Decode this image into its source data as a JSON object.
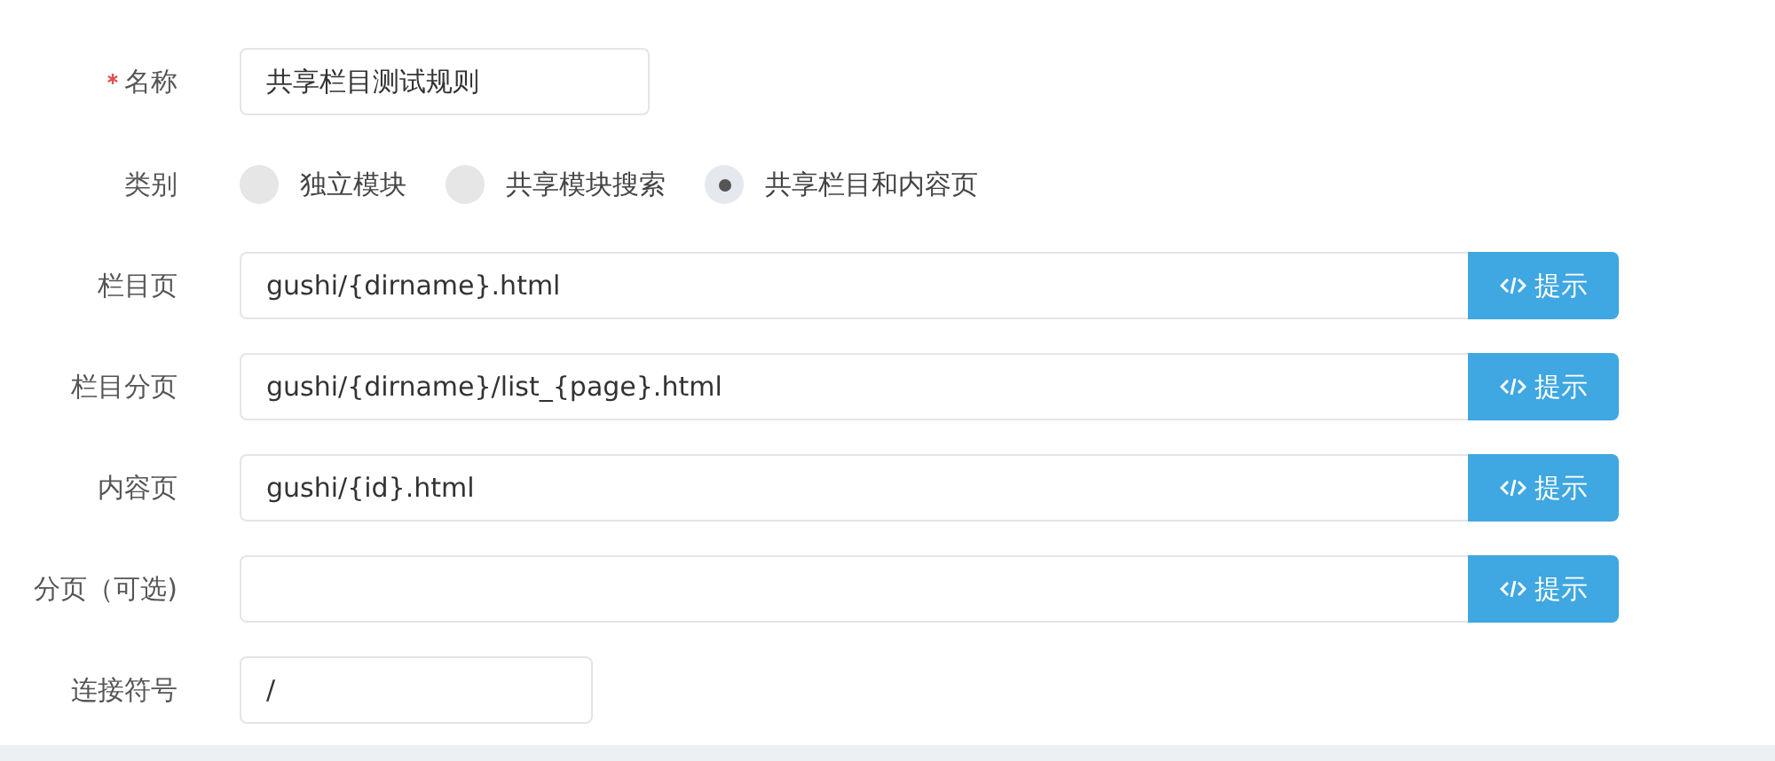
{
  "name_field": {
    "label": "名称",
    "required": true,
    "value": "共享栏目测试规则"
  },
  "category": {
    "label": "类别",
    "options": [
      {
        "label": "独立模块",
        "selected": false
      },
      {
        "label": "共享模块搜索",
        "selected": false
      },
      {
        "label": "共享栏目和内容页",
        "selected": true
      }
    ]
  },
  "url_rules": [
    {
      "label": "栏目页",
      "value": "gushi/{dirname}.html",
      "button": "提示"
    },
    {
      "label": "栏目分页",
      "value": "gushi/{dirname}/list_{page}.html",
      "button": "提示"
    },
    {
      "label": "内容页",
      "value": "gushi/{id}.html",
      "button": "提示"
    },
    {
      "label": "分页（可选)",
      "button": "提示"
    }
  ],
  "separator": {
    "label": "连接符号",
    "value": "/"
  }
}
